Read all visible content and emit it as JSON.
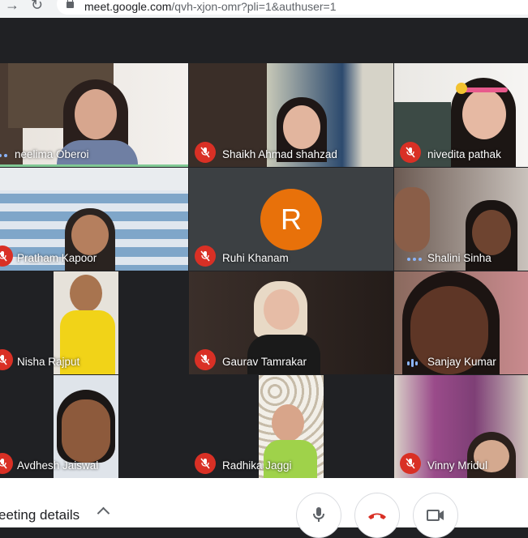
{
  "browser": {
    "url_host": "meet.google.com",
    "url_path": "/qvh-xjon-omr?pli=1&authuser=1"
  },
  "participants": [
    {
      "name": "neelima Oberoi",
      "muted": false,
      "status": "speaking-dots"
    },
    {
      "name": "Shaikh Ahmad shahzad",
      "muted": true
    },
    {
      "name": "nivedita pathak",
      "muted": true
    },
    {
      "name": "Pratham Kapoor",
      "muted": true
    },
    {
      "name": "Ruhi Khanam",
      "muted": true,
      "avatar_letter": "R",
      "avatar_color": "#e8710a"
    },
    {
      "name": "Shalini Sinha",
      "muted": false,
      "status": "speaking-dots"
    },
    {
      "name": "Nisha Rajput",
      "muted": true
    },
    {
      "name": "Gaurav Tamrakar",
      "muted": true
    },
    {
      "name": "Sanjay Kumar",
      "muted": false,
      "status": "speaking-bars"
    },
    {
      "name": "Avdhesh Jaiswal",
      "muted": true
    },
    {
      "name": "Radhika Jaggi",
      "muted": true
    },
    {
      "name": "Vinny Mridul",
      "muted": true
    }
  ],
  "footer": {
    "details_label": "eeting details",
    "buttons": [
      "microphone-icon",
      "end-call-icon",
      "camera-icon"
    ]
  },
  "colors": {
    "mute": "#d93025",
    "active": "#81c995",
    "accent": "#8ab4f8"
  }
}
